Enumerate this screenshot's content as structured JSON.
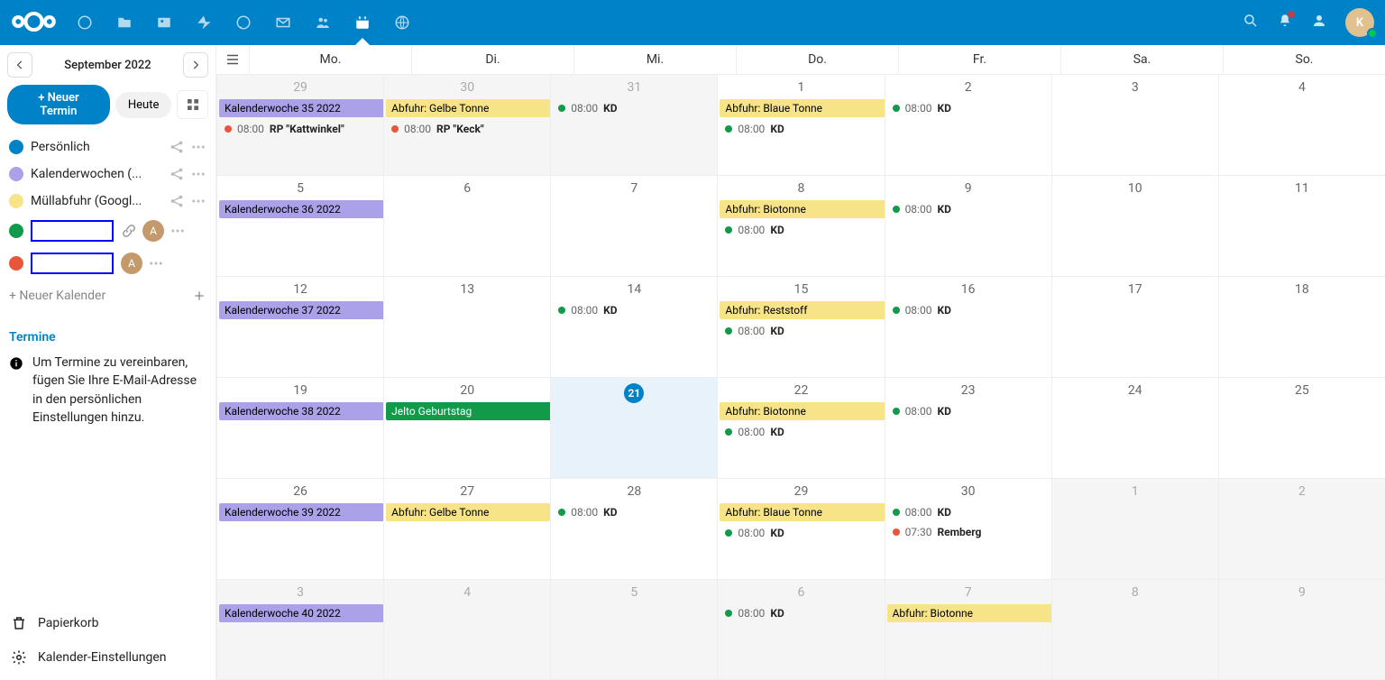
{
  "header": {
    "avatar_letter": "K"
  },
  "nav": {
    "month_label": "September 2022",
    "new_event": "+ Neuer Termin",
    "today": "Heute"
  },
  "calendars": [
    {
      "name": "Persönlich",
      "color": "#0082c9",
      "share": true
    },
    {
      "name": "Kalenderwochen (...",
      "color": "#aba1e8",
      "share": true
    },
    {
      "name": "Müllabfuhr (Googl...",
      "color": "#f7e388",
      "share": true
    },
    {
      "name": "",
      "color": "#119a49",
      "redact": true,
      "shared_letter": "A",
      "link": true
    },
    {
      "name": "",
      "color": "#e9553b",
      "redact": true,
      "shared_letter": "A"
    }
  ],
  "new_calendar": "+ Neuer Kalender",
  "appointments": {
    "title": "Termine",
    "info": "Um Termine zu vereinbaren, fügen Sie Ihre E-Mail-Adresse in den persönlichen Einstellungen hinzu."
  },
  "footer": {
    "trash": "Papierkorb",
    "settings": "Kalender-Einstellungen"
  },
  "day_names": [
    "Mo.",
    "Di.",
    "Mi.",
    "Do.",
    "Fr.",
    "Sa.",
    "So."
  ],
  "colors": {
    "green": "#119a49",
    "orange": "#e9553b"
  },
  "weeks": [
    {
      "days": [
        {
          "num": "29",
          "other": true,
          "events": [
            {
              "kind": "bar",
              "cls": "ev-purple span",
              "text": "Kalenderwoche 35 2022"
            },
            {
              "kind": "timed",
              "dot": "orange",
              "time": "08:00",
              "title": "RP \"Kattwinkel\""
            }
          ]
        },
        {
          "num": "30",
          "other": true,
          "events": [
            {
              "kind": "bar",
              "cls": "ev-yellow span",
              "text": "Abfuhr: Gelbe Tonne"
            },
            {
              "kind": "timed",
              "dot": "orange",
              "time": "08:00",
              "title": "RP \"Keck\""
            }
          ]
        },
        {
          "num": "31",
          "other": true,
          "events": [
            {
              "kind": "timed",
              "dot": "green",
              "time": "08:00",
              "title": "KD"
            }
          ]
        },
        {
          "num": "1",
          "events": [
            {
              "kind": "bar",
              "cls": "ev-yellow span",
              "text": "Abfuhr: Blaue Tonne"
            },
            {
              "kind": "timed",
              "dot": "green",
              "time": "08:00",
              "title": "KD"
            }
          ]
        },
        {
          "num": "2",
          "events": [
            {
              "kind": "timed",
              "dot": "green",
              "time": "08:00",
              "title": "KD"
            }
          ]
        },
        {
          "num": "3",
          "events": []
        },
        {
          "num": "4",
          "events": []
        }
      ]
    },
    {
      "days": [
        {
          "num": "5",
          "events": [
            {
              "kind": "bar",
              "cls": "ev-purple span",
              "text": "Kalenderwoche 36 2022"
            }
          ]
        },
        {
          "num": "6",
          "events": []
        },
        {
          "num": "7",
          "events": []
        },
        {
          "num": "8",
          "events": [
            {
              "kind": "bar",
              "cls": "ev-yellow span",
              "text": "Abfuhr: Biotonne"
            },
            {
              "kind": "timed",
              "dot": "green",
              "time": "08:00",
              "title": "KD"
            }
          ]
        },
        {
          "num": "9",
          "events": [
            {
              "kind": "timed",
              "dot": "green",
              "time": "08:00",
              "title": "KD"
            }
          ]
        },
        {
          "num": "10",
          "events": []
        },
        {
          "num": "11",
          "events": []
        }
      ]
    },
    {
      "days": [
        {
          "num": "12",
          "events": [
            {
              "kind": "bar",
              "cls": "ev-purple span",
              "text": "Kalenderwoche 37 2022"
            }
          ]
        },
        {
          "num": "13",
          "events": []
        },
        {
          "num": "14",
          "events": [
            {
              "kind": "timed",
              "dot": "green",
              "time": "08:00",
              "title": "KD"
            }
          ]
        },
        {
          "num": "15",
          "events": [
            {
              "kind": "bar",
              "cls": "ev-yellow span",
              "text": "Abfuhr: Reststoff"
            },
            {
              "kind": "timed",
              "dot": "green",
              "time": "08:00",
              "title": "KD"
            }
          ]
        },
        {
          "num": "16",
          "events": [
            {
              "kind": "timed",
              "dot": "green",
              "time": "08:00",
              "title": "KD"
            }
          ]
        },
        {
          "num": "17",
          "events": []
        },
        {
          "num": "18",
          "events": []
        }
      ]
    },
    {
      "days": [
        {
          "num": "19",
          "events": [
            {
              "kind": "bar",
              "cls": "ev-purple span",
              "text": "Kalenderwoche 38 2022"
            }
          ]
        },
        {
          "num": "20",
          "events": [
            {
              "kind": "bar",
              "cls": "ev-green span",
              "text": "Jelto Geburtstag"
            }
          ]
        },
        {
          "num": "21",
          "today": true,
          "events": []
        },
        {
          "num": "22",
          "events": [
            {
              "kind": "bar",
              "cls": "ev-yellow span",
              "text": "Abfuhr: Biotonne"
            },
            {
              "kind": "timed",
              "dot": "green",
              "time": "08:00",
              "title": "KD"
            }
          ]
        },
        {
          "num": "23",
          "events": [
            {
              "kind": "timed",
              "dot": "green",
              "time": "08:00",
              "title": "KD"
            }
          ]
        },
        {
          "num": "24",
          "events": []
        },
        {
          "num": "25",
          "events": []
        }
      ]
    },
    {
      "days": [
        {
          "num": "26",
          "events": [
            {
              "kind": "bar",
              "cls": "ev-purple span",
              "text": "Kalenderwoche 39 2022"
            }
          ]
        },
        {
          "num": "27",
          "events": [
            {
              "kind": "bar",
              "cls": "ev-yellow span",
              "text": "Abfuhr: Gelbe Tonne"
            }
          ]
        },
        {
          "num": "28",
          "events": [
            {
              "kind": "timed",
              "dot": "green",
              "time": "08:00",
              "title": "KD"
            }
          ]
        },
        {
          "num": "29",
          "events": [
            {
              "kind": "bar",
              "cls": "ev-yellow span",
              "text": "Abfuhr: Blaue Tonne"
            },
            {
              "kind": "timed",
              "dot": "green",
              "time": "08:00",
              "title": "KD"
            }
          ]
        },
        {
          "num": "30",
          "events": [
            {
              "kind": "timed",
              "dot": "green",
              "time": "08:00",
              "title": "KD"
            },
            {
              "kind": "timed",
              "dot": "orange",
              "time": "07:30",
              "title": "Remberg"
            }
          ]
        },
        {
          "num": "1",
          "other": true,
          "events": []
        },
        {
          "num": "2",
          "other": true,
          "events": []
        }
      ]
    },
    {
      "days": [
        {
          "num": "3",
          "other": true,
          "events": [
            {
              "kind": "bar",
              "cls": "ev-purple span",
              "text": "Kalenderwoche 40 2022"
            }
          ]
        },
        {
          "num": "4",
          "other": true,
          "events": []
        },
        {
          "num": "5",
          "other": true,
          "events": []
        },
        {
          "num": "6",
          "other": true,
          "events": [
            {
              "kind": "timed",
              "dot": "green",
              "time": "08:00",
              "title": "KD"
            }
          ]
        },
        {
          "num": "7",
          "other": true,
          "events": [
            {
              "kind": "bar",
              "cls": "ev-yellow span",
              "text": "Abfuhr: Biotonne"
            }
          ]
        },
        {
          "num": "8",
          "other": true,
          "events": []
        },
        {
          "num": "9",
          "other": true,
          "events": []
        }
      ]
    }
  ]
}
